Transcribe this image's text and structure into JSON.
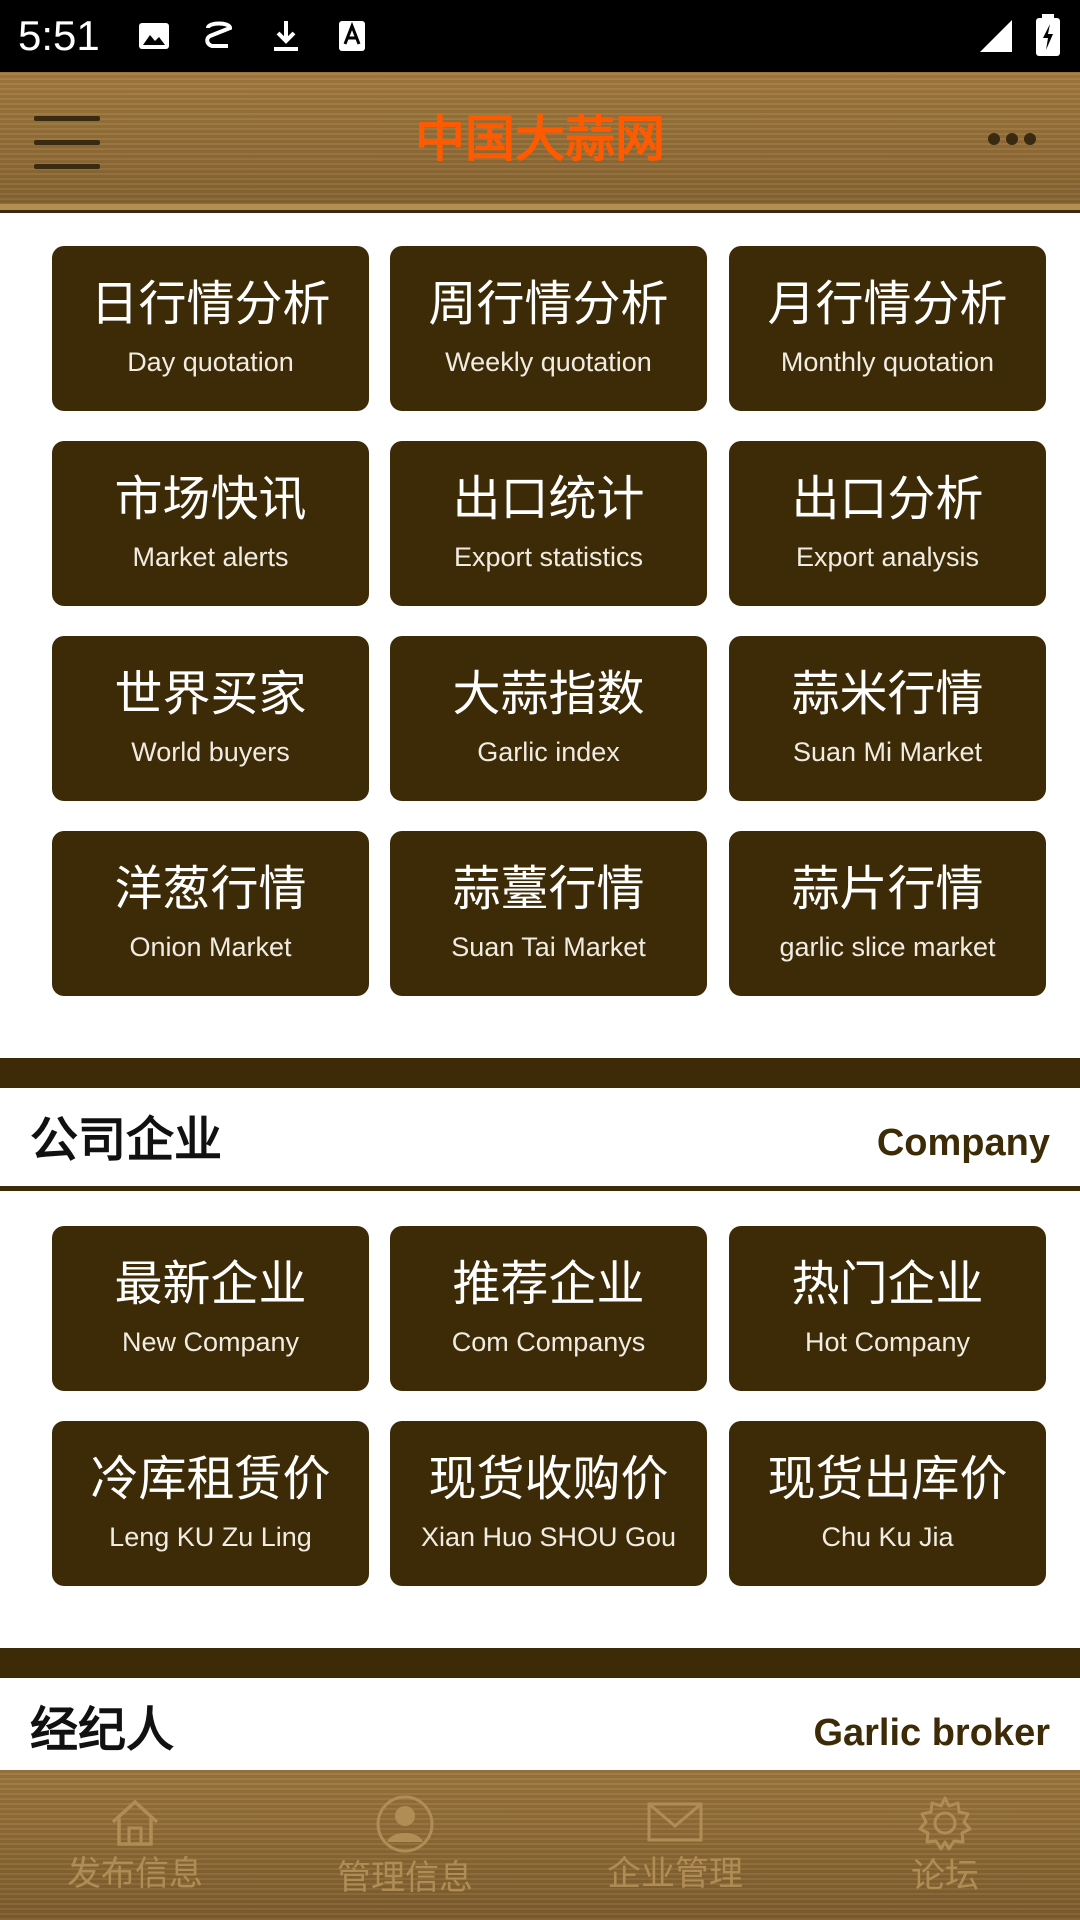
{
  "status_bar": {
    "time": "5:51",
    "icons": [
      "image-icon",
      "s-app-icon",
      "download-icon",
      "font-a-icon",
      "signal-icon",
      "battery-icon"
    ]
  },
  "app_bar": {
    "title": "中国大蒜网",
    "title_color": "#ff5a00",
    "menu_icon": "hamburger-menu-icon",
    "more_icon": "more-horizontal-icon"
  },
  "market_tiles": [
    {
      "cn": "日行情分析",
      "en": "Day quotation"
    },
    {
      "cn": "周行情分析",
      "en": "Weekly quotation"
    },
    {
      "cn": "月行情分析",
      "en": "Monthly quotation"
    },
    {
      "cn": "市场快讯",
      "en": "Market alerts"
    },
    {
      "cn": "出口统计",
      "en": "Export statistics"
    },
    {
      "cn": "出口分析",
      "en": "Export analysis"
    },
    {
      "cn": "世界买家",
      "en": "World buyers"
    },
    {
      "cn": "大蒜指数",
      "en": "Garlic index"
    },
    {
      "cn": "蒜米行情",
      "en": "Suan Mi Market"
    },
    {
      "cn": "洋葱行情",
      "en": "Onion Market"
    },
    {
      "cn": "蒜薹行情",
      "en": "Suan Tai Market"
    },
    {
      "cn": "蒜片行情",
      "en": "garlic slice market"
    }
  ],
  "company_section": {
    "title": "公司企业",
    "title_en": "Company",
    "tiles": [
      {
        "cn": "最新企业",
        "en": "New Company"
      },
      {
        "cn": "推荐企业",
        "en": "Com Companys"
      },
      {
        "cn": "热门企业",
        "en": "Hot Company"
      },
      {
        "cn": "冷库租赁价",
        "en": "Leng KU Zu Ling"
      },
      {
        "cn": "现货收购价",
        "en": "Xian Huo SHOU Gou"
      },
      {
        "cn": "现货出库价",
        "en": "Chu Ku Jia"
      }
    ]
  },
  "broker_section": {
    "title": "经纪人",
    "title_en": "Garlic broker"
  },
  "bottom_nav": [
    {
      "label": "发布信息",
      "icon": "home-icon"
    },
    {
      "label": "管理信息",
      "icon": "user-icon"
    },
    {
      "label": "企业管理",
      "icon": "mail-icon"
    },
    {
      "label": "论坛",
      "icon": "gear-icon"
    }
  ],
  "colors": {
    "tile_bg": "#3d2b08",
    "app_bar": "#9a743a",
    "nav_label": "#b08d55"
  }
}
